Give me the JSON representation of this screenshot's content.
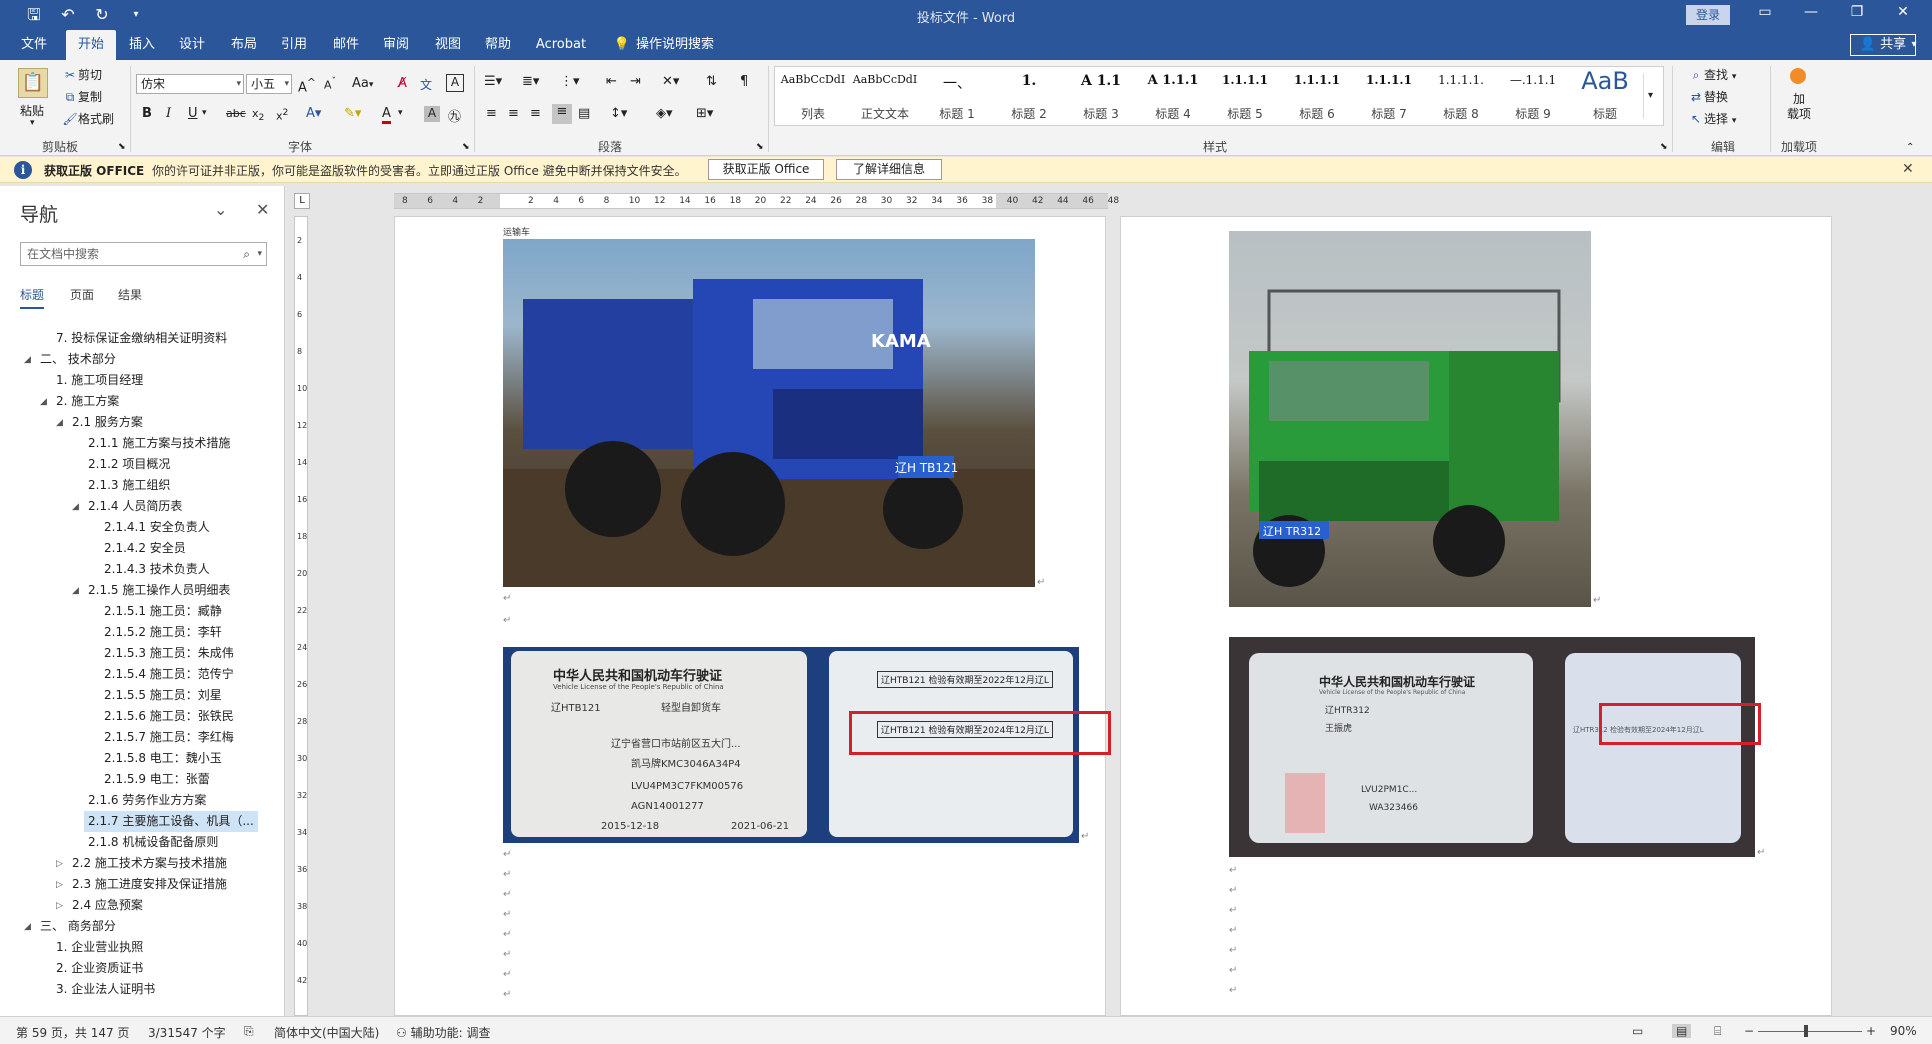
{
  "window": {
    "title": "投标文件 - Word",
    "login_label": "登录",
    "qat_save_icon": "save-icon",
    "qat_undo_icon": "undo-icon",
    "qat_redo_icon": "redo-icon"
  },
  "tabs": {
    "items": [
      "文件",
      "开始",
      "插入",
      "设计",
      "布局",
      "引用",
      "邮件",
      "审阅",
      "视图",
      "帮助",
      "Acrobat"
    ],
    "active": "开始",
    "tell_me": "操作说明搜索",
    "share": "共享"
  },
  "ribbon": {
    "clipboard": {
      "paste": "粘贴",
      "cut": "剪切",
      "copy": "复制",
      "format_painter": "格式刷",
      "label": "剪贴板"
    },
    "font": {
      "name": "仿宋",
      "size": "小五",
      "case_label": "Aa",
      "label": "字体"
    },
    "paragraph": {
      "label": "段落"
    },
    "styles": {
      "label": "样式",
      "items": [
        {
          "preview": "AaBbCcDdI",
          "name": "列表"
        },
        {
          "preview": "AaBbCcDdI",
          "name": "正文文本"
        },
        {
          "preview": "一、",
          "name": "标题 1"
        },
        {
          "preview": "1.",
          "name": "标题 2"
        },
        {
          "preview": "A 1.1",
          "name": "标题 3"
        },
        {
          "preview": "A 1.1.1",
          "name": "标题 4"
        },
        {
          "preview": "1.1.1.1",
          "name": "标题 5"
        },
        {
          "preview": "1.1.1.1",
          "name": "标题 6"
        },
        {
          "preview": "1.1.1.1",
          "name": "标题 7"
        },
        {
          "preview": "1.1.1.1.",
          "name": "标题 8"
        },
        {
          "preview": "—.1.1.1",
          "name": "标题 9"
        },
        {
          "preview": "AaB",
          "name": "标题"
        }
      ]
    },
    "editing": {
      "find": "查找",
      "replace": "替换",
      "select": "选择",
      "label": "编辑"
    },
    "addins": {
      "button": "加\n载项",
      "label": "加载项"
    }
  },
  "infobar": {
    "title": "获取正版 OFFICE",
    "message": "你的许可证并非正版，你可能是盗版软件的受害者。立即通过正版 Office 避免中断并保持文件安全。",
    "btn_get": "获取正版 Office",
    "btn_learn": "了解详细信息"
  },
  "nav": {
    "title": "导航",
    "search_placeholder": "在文档中搜索",
    "tabs": [
      "标题",
      "页面",
      "结果"
    ],
    "tree": [
      {
        "text": "7. 投标保证金缴纳相关证明资料",
        "level": 2,
        "toggle": ""
      },
      {
        "text": "二、 技术部分",
        "level": 1,
        "toggle": "open"
      },
      {
        "text": "1. 施工项目经理",
        "level": 2,
        "toggle": ""
      },
      {
        "text": "2. 施工方案",
        "level": 2,
        "toggle": "open"
      },
      {
        "text": "2.1 服务方案",
        "level": 3,
        "toggle": "open"
      },
      {
        "text": "2.1.1 施工方案与技术措施",
        "level": 4,
        "toggle": ""
      },
      {
        "text": "2.1.2 项目概况",
        "level": 4,
        "toggle": ""
      },
      {
        "text": "2.1.3 施工组织",
        "level": 4,
        "toggle": ""
      },
      {
        "text": "2.1.4 人员简历表",
        "level": 4,
        "toggle": "open"
      },
      {
        "text": "2.1.4.1 安全负责人",
        "level": 5,
        "toggle": ""
      },
      {
        "text": "2.1.4.2 安全员",
        "level": 5,
        "toggle": ""
      },
      {
        "text": "2.1.4.3 技术负责人",
        "level": 5,
        "toggle": ""
      },
      {
        "text": "2.1.5 施工操作人员明细表",
        "level": 4,
        "toggle": "open"
      },
      {
        "text": "2.1.5.1 施工员：臧静",
        "level": 5,
        "toggle": ""
      },
      {
        "text": "2.1.5.2 施工员：李轩",
        "level": 5,
        "toggle": ""
      },
      {
        "text": "2.1.5.3 施工员：朱成伟",
        "level": 5,
        "toggle": ""
      },
      {
        "text": "2.1.5.4 施工员：范传宁",
        "level": 5,
        "toggle": ""
      },
      {
        "text": "2.1.5.5 施工员：刘星",
        "level": 5,
        "toggle": ""
      },
      {
        "text": "2.1.5.6 施工员：张铁民",
        "level": 5,
        "toggle": ""
      },
      {
        "text": "2.1.5.7 施工员：李红梅",
        "level": 5,
        "toggle": ""
      },
      {
        "text": "2.1.5.8 电工：魏小玉",
        "level": 5,
        "toggle": ""
      },
      {
        "text": "2.1.5.9 电工：张蕾",
        "level": 5,
        "toggle": ""
      },
      {
        "text": "2.1.6 劳务作业方方案",
        "level": 4,
        "toggle": ""
      },
      {
        "text": "2.1.7 主要施工设备、机具（...",
        "level": 4,
        "toggle": "",
        "selected": true
      },
      {
        "text": "2.1.8 机械设备配备原则",
        "level": 4,
        "toggle": ""
      },
      {
        "text": "2.2 施工技术方案与技术措施",
        "level": 3,
        "toggle": "closed"
      },
      {
        "text": "2.3 施工进度安排及保证措施",
        "level": 3,
        "toggle": "closed"
      },
      {
        "text": "2.4 应急预案",
        "level": 3,
        "toggle": "closed"
      },
      {
        "text": "三、 商务部分",
        "level": 1,
        "toggle": "open"
      },
      {
        "text": "1. 企业营业执照",
        "level": 2,
        "toggle": ""
      },
      {
        "text": "2. 企业资质证书",
        "level": 2,
        "toggle": ""
      },
      {
        "text": "3. 企业法人证明书",
        "level": 2,
        "toggle": ""
      }
    ]
  },
  "ruler": {
    "ticks": [
      "8",
      "6",
      "4",
      "2",
      "",
      "2",
      "4",
      "6",
      "8",
      "10",
      "12",
      "14",
      "16",
      "18",
      "20",
      "22",
      "24",
      "26",
      "28",
      "30",
      "32",
      "34",
      "36",
      "38",
      "40",
      "42",
      "44",
      "46",
      "48"
    ],
    "vticks": [
      "2",
      "4",
      "6",
      "8",
      "10",
      "12",
      "14",
      "16",
      "18",
      "20",
      "22",
      "24",
      "26",
      "28",
      "30",
      "32",
      "34",
      "36",
      "38",
      "40",
      "42"
    ]
  },
  "document": {
    "page1_header_text": "运输车",
    "truck1_plate": "辽H TB121",
    "truck1_brand": "KAMA",
    "truck2_plate": "辽H TR312",
    "license1": {
      "title": "中华人民共和国机动车行驶证",
      "subtitle": "Vehicle License of the People's Republic of China",
      "plate": "辽HTB121",
      "type": "轻型自卸货车",
      "address": "辽宁省营口市站前区五大门...",
      "model": "凯马牌KMC3046A34P4",
      "vin": "LVU4PM3C7FKM00576",
      "engine": "AGN14001277",
      "reg_date": "2015-12-18",
      "issue_date": "2021-06-21",
      "stamp1": "辽HTB121 检验有效期至2022年12月辽L",
      "stamp2": "辽HTB121 检验有效期至2024年12月辽L"
    },
    "license2": {
      "title": "中华人民共和国机动车行驶证",
      "subtitle": "Vehicle License of the People's Republic of China",
      "plate": "辽HTR312",
      "owner": "王振虎",
      "vin": "LVU2PM1C...",
      "engine": "WA323466",
      "stamp": "辽HTR312 检验有效期至2024年12月辽L"
    }
  },
  "status": {
    "page": "第 59 页，共 147 页",
    "words": "3/31547 个字",
    "language": "简体中文(中国大陆)",
    "accessibility": "辅助功能: 调查",
    "zoom": "90%"
  },
  "colors": {
    "accent": "#2b579a",
    "infobar_bg": "#fff4ce",
    "highlight_box": "#d3202a",
    "truck1_body": "#1f3fa8",
    "truck2_body": "#2a9b3a"
  }
}
